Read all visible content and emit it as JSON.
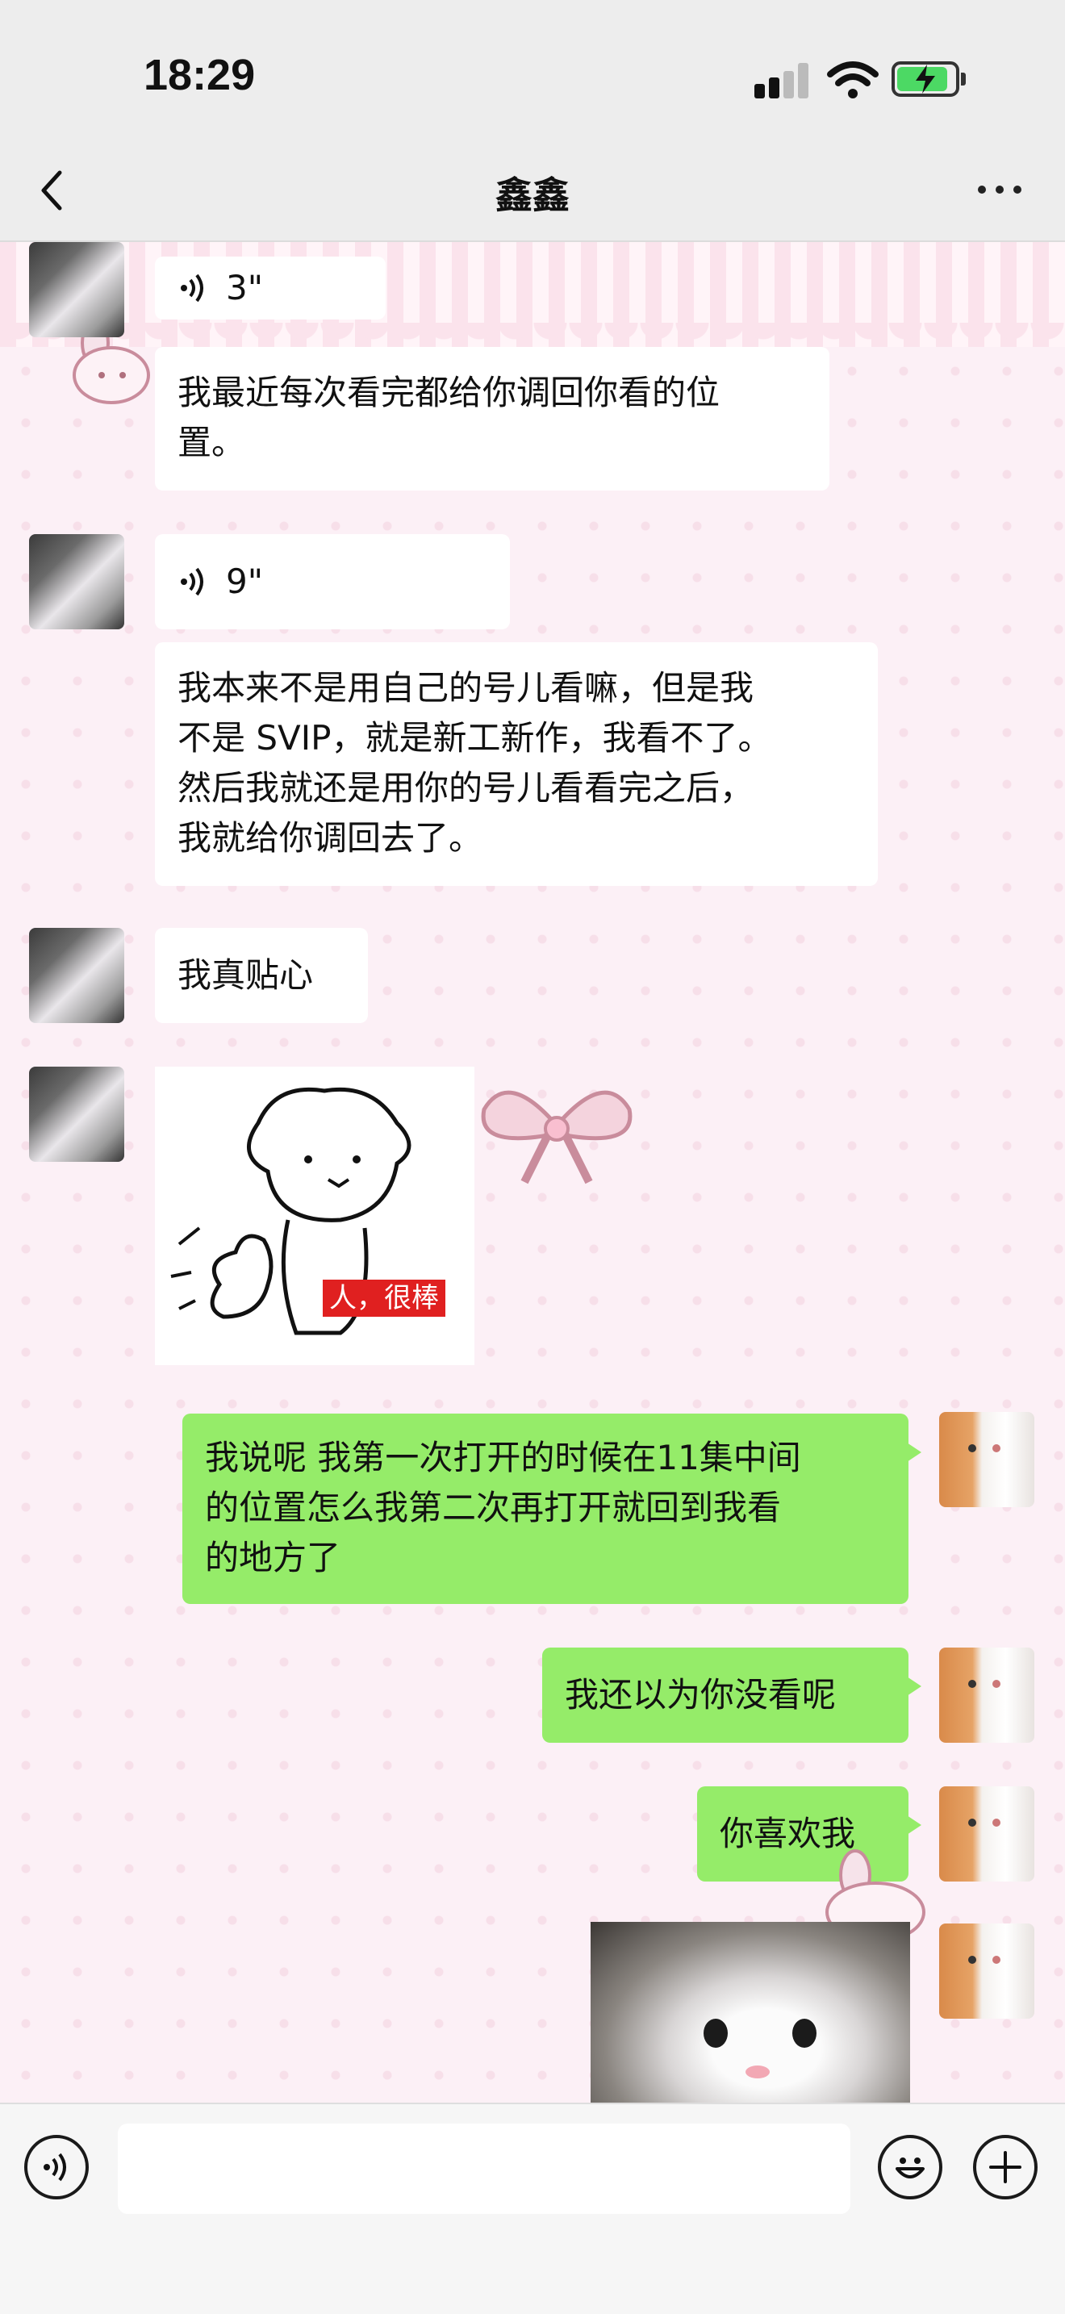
{
  "status_bar": {
    "time": "18:29"
  },
  "nav": {
    "title": "鑫鑫"
  },
  "messages": [
    {
      "side": "in",
      "type": "voice",
      "duration": "3\""
    },
    {
      "side": "in",
      "type": "text",
      "lines": [
        "我最近每次看完都给你调回你看的位",
        "置。"
      ]
    },
    {
      "side": "in",
      "type": "voice",
      "duration": "9\""
    },
    {
      "side": "in",
      "type": "text",
      "lines": [
        "我本来不是用自己的号儿看嘛，但是我",
        "不是 SVIP，就是新工新作，我看不了。",
        "然后我就还是用你的号儿看看完之后，",
        "我就给你调回去了。"
      ]
    },
    {
      "side": "in",
      "type": "text",
      "lines": [
        "我真贴心"
      ]
    },
    {
      "side": "in",
      "type": "sticker",
      "label": "人，很棒"
    },
    {
      "side": "out",
      "type": "text",
      "lines": [
        "我说呢 我第一次打开的时候在11集中间",
        "的位置怎么我第二次再打开就回到我看",
        "的地方了"
      ]
    },
    {
      "side": "out",
      "type": "text",
      "lines": [
        "我还以为你没看呢"
      ]
    },
    {
      "side": "out",
      "type": "text",
      "lines": [
        "你喜欢我"
      ]
    },
    {
      "side": "out",
      "type": "image"
    }
  ],
  "input_bar": {
    "placeholder": "",
    "value": ""
  },
  "icons": {
    "back": "chevron-left-icon",
    "more": "more-icon",
    "voice": "voice-wave-icon",
    "emoji": "emoji-icon",
    "add": "plus-icon"
  },
  "colors": {
    "outgoing_bubble": "#95ec69",
    "incoming_bubble": "#ffffff",
    "nav_bg": "#ededed"
  }
}
